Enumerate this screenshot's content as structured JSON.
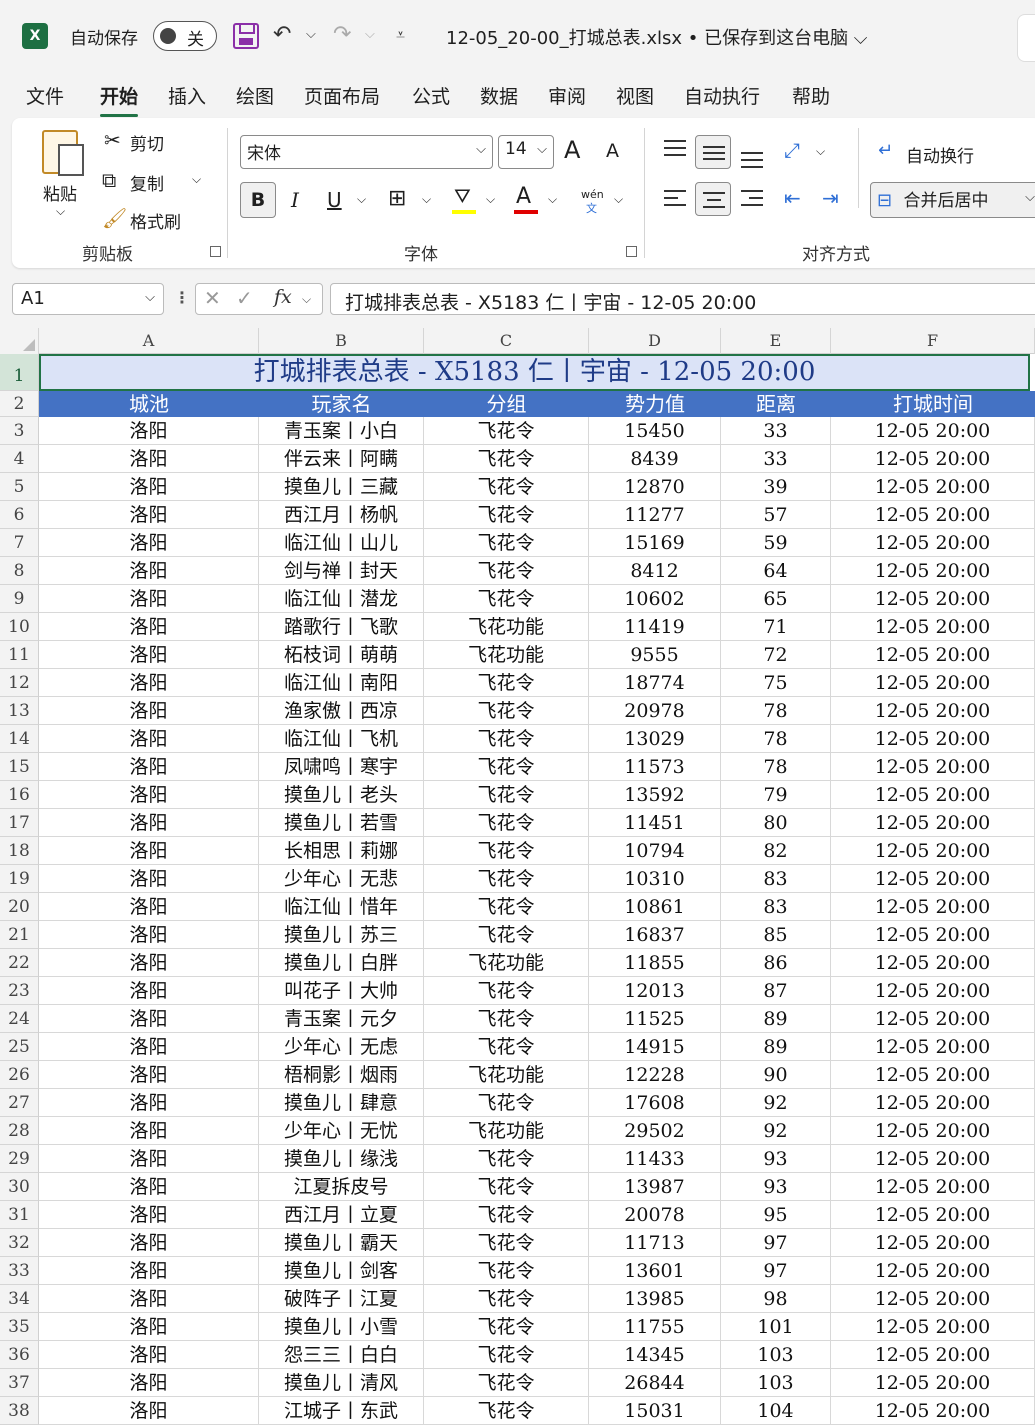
{
  "titlebar": {
    "app_icon": "X",
    "autosave_label": "自动保存",
    "autosave_state": "关",
    "file_title": "12-05_20-00_打城总表.xlsx • 已保存到这台电脑 ⌵"
  },
  "menu": [
    "文件",
    "开始",
    "插入",
    "绘图",
    "页面布局",
    "公式",
    "数据",
    "审阅",
    "视图",
    "自动执行",
    "帮助"
  ],
  "ribbon": {
    "paste": "粘贴",
    "cut": "剪切",
    "copy": "复制",
    "format_painter": "格式刷",
    "clipboard_group": "剪贴板",
    "font_name": "宋体",
    "font_size": "14",
    "bold": "B",
    "italic": "I",
    "underline": "U",
    "font_group": "字体",
    "wrap_text": "自动换行",
    "merge_center": "合并后居中",
    "align_group": "对齐方式",
    "grow_font": "A",
    "shrink_font": "A",
    "font_color_glyph": "A",
    "phonetic_top": "wén",
    "phonetic_bottom": "文",
    "fill_color": "#ffff00",
    "font_color": "#e00000"
  },
  "formula_bar": {
    "name_box": "A1",
    "fx": "fx",
    "content": "打城排表总表 - X5183 仁丨宇宙 - 12-05 20:00"
  },
  "sheet": {
    "columns": [
      "A",
      "B",
      "C",
      "D",
      "E",
      "F"
    ],
    "title": "打城排表总表 - X5183 仁丨宇宙 - 12-05 20:00",
    "headers": [
      "城池",
      "玩家名",
      "分组",
      "势力值",
      "距离",
      "打城时间"
    ],
    "header_color": "#4472c4",
    "title_fill": "#dbe3f7",
    "rows": [
      [
        "洛阳",
        "青玉案丨小白",
        "飞花令",
        "15450",
        "33",
        "12-05 20:00"
      ],
      [
        "洛阳",
        "伴云来丨阿瞒",
        "飞花令",
        "8439",
        "33",
        "12-05 20:00"
      ],
      [
        "洛阳",
        "摸鱼儿丨三藏",
        "飞花令",
        "12870",
        "39",
        "12-05 20:00"
      ],
      [
        "洛阳",
        "西江月丨杨帆",
        "飞花令",
        "11277",
        "57",
        "12-05 20:00"
      ],
      [
        "洛阳",
        "临江仙丨山儿",
        "飞花令",
        "15169",
        "59",
        "12-05 20:00"
      ],
      [
        "洛阳",
        "剑与禅丨封天",
        "飞花令",
        "8412",
        "64",
        "12-05 20:00"
      ],
      [
        "洛阳",
        "临江仙丨潜龙",
        "飞花令",
        "10602",
        "65",
        "12-05 20:00"
      ],
      [
        "洛阳",
        "踏歌行丨飞歌",
        "飞花功能",
        "11419",
        "71",
        "12-05 20:00"
      ],
      [
        "洛阳",
        "柘枝词丨萌萌",
        "飞花功能",
        "9555",
        "72",
        "12-05 20:00"
      ],
      [
        "洛阳",
        "临江仙丨南阳",
        "飞花令",
        "18774",
        "75",
        "12-05 20:00"
      ],
      [
        "洛阳",
        "渔家傲丨西凉",
        "飞花令",
        "20978",
        "78",
        "12-05 20:00"
      ],
      [
        "洛阳",
        "临江仙丨飞机",
        "飞花令",
        "13029",
        "78",
        "12-05 20:00"
      ],
      [
        "洛阳",
        "凤啸鸣丨寒宇",
        "飞花令",
        "11573",
        "78",
        "12-05 20:00"
      ],
      [
        "洛阳",
        "摸鱼儿丨老头",
        "飞花令",
        "13592",
        "79",
        "12-05 20:00"
      ],
      [
        "洛阳",
        "摸鱼儿丨若雪",
        "飞花令",
        "11451",
        "80",
        "12-05 20:00"
      ],
      [
        "洛阳",
        "长相思丨莉娜",
        "飞花令",
        "10794",
        "82",
        "12-05 20:00"
      ],
      [
        "洛阳",
        "少年心丨无悲",
        "飞花令",
        "10310",
        "83",
        "12-05 20:00"
      ],
      [
        "洛阳",
        "临江仙丨惜年",
        "飞花令",
        "10861",
        "83",
        "12-05 20:00"
      ],
      [
        "洛阳",
        "摸鱼儿丨苏三",
        "飞花令",
        "16837",
        "85",
        "12-05 20:00"
      ],
      [
        "洛阳",
        "摸鱼儿丨白胖",
        "飞花功能",
        "11855",
        "86",
        "12-05 20:00"
      ],
      [
        "洛阳",
        "叫花子丨大帅",
        "飞花令",
        "12013",
        "87",
        "12-05 20:00"
      ],
      [
        "洛阳",
        "青玉案丨元夕",
        "飞花令",
        "11525",
        "89",
        "12-05 20:00"
      ],
      [
        "洛阳",
        "少年心丨无虑",
        "飞花令",
        "14915",
        "89",
        "12-05 20:00"
      ],
      [
        "洛阳",
        "梧桐影丨烟雨",
        "飞花功能",
        "12228",
        "90",
        "12-05 20:00"
      ],
      [
        "洛阳",
        "摸鱼儿丨肆意",
        "飞花令",
        "17608",
        "92",
        "12-05 20:00"
      ],
      [
        "洛阳",
        "少年心丨无忧",
        "飞花功能",
        "29502",
        "92",
        "12-05 20:00"
      ],
      [
        "洛阳",
        "摸鱼儿丨缘浅",
        "飞花令",
        "11433",
        "93",
        "12-05 20:00"
      ],
      [
        "洛阳",
        "江夏拆皮号",
        "飞花令",
        "13987",
        "93",
        "12-05 20:00"
      ],
      [
        "洛阳",
        "西江月丨立夏",
        "飞花令",
        "20078",
        "95",
        "12-05 20:00"
      ],
      [
        "洛阳",
        "摸鱼儿丨霸天",
        "飞花令",
        "11713",
        "97",
        "12-05 20:00"
      ],
      [
        "洛阳",
        "摸鱼儿丨剑客",
        "飞花令",
        "13601",
        "97",
        "12-05 20:00"
      ],
      [
        "洛阳",
        "破阵子丨江夏",
        "飞花令",
        "13985",
        "98",
        "12-05 20:00"
      ],
      [
        "洛阳",
        "摸鱼儿丨小雪",
        "飞花令",
        "11755",
        "101",
        "12-05 20:00"
      ],
      [
        "洛阳",
        "怨三三丨白白",
        "飞花令",
        "14345",
        "103",
        "12-05 20:00"
      ],
      [
        "洛阳",
        "摸鱼儿丨清风",
        "飞花令",
        "26844",
        "103",
        "12-05 20:00"
      ],
      [
        "洛阳",
        "江城子丨东武",
        "飞花令",
        "15031",
        "104",
        "12-05 20:00"
      ]
    ]
  }
}
